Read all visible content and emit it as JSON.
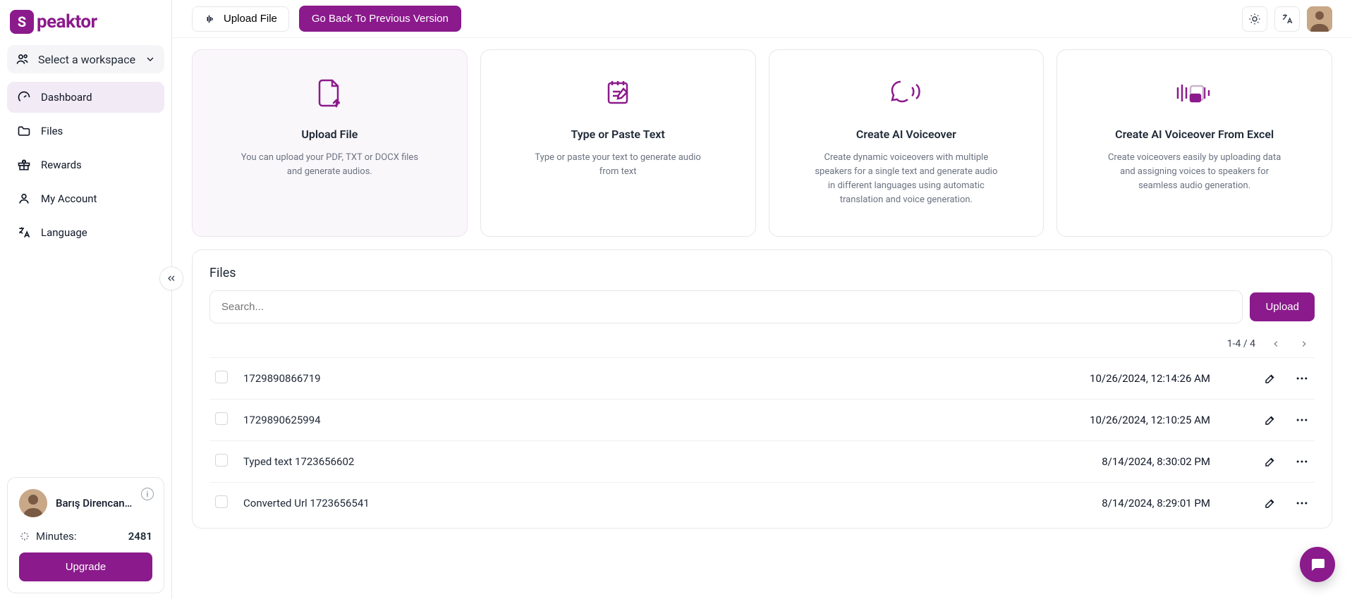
{
  "brand": {
    "name": "peaktor",
    "mark": "S"
  },
  "workspace": {
    "label": "Select a workspace"
  },
  "nav": {
    "dashboard": "Dashboard",
    "files": "Files",
    "rewards": "Rewards",
    "account": "My Account",
    "language": "Language"
  },
  "sidebarFooter": {
    "name": "Barış Direncan ...",
    "minutesLabel": "Minutes:",
    "minutesValue": "2481",
    "upgrade": "Upgrade"
  },
  "topbar": {
    "uploadFile": "Upload File",
    "goBack": "Go Back To Previous Version"
  },
  "cards": [
    {
      "title": "Upload File",
      "desc": "You can upload your PDF, TXT or DOCX files and generate audios."
    },
    {
      "title": "Type or Paste Text",
      "desc": "Type or paste your text to generate audio from text"
    },
    {
      "title": "Create AI Voiceover",
      "desc": "Create dynamic voiceovers with multiple speakers for a single text and generate audio in different languages using automatic translation and voice generation."
    },
    {
      "title": "Create AI Voiceover From Excel",
      "desc": "Create voiceovers easily by uploading data and assigning voices to speakers for seamless audio generation."
    }
  ],
  "files": {
    "heading": "Files",
    "searchPlaceholder": "Search...",
    "uploadLabel": "Upload",
    "pager": "1-4 / 4",
    "rows": [
      {
        "name": "1729890866719",
        "date": "10/26/2024, 12:14:26 AM"
      },
      {
        "name": "1729890625994",
        "date": "10/26/2024, 12:10:25 AM"
      },
      {
        "name": "Typed text 1723656602",
        "date": "8/14/2024, 8:30:02 PM"
      },
      {
        "name": "Converted Url 1723656541",
        "date": "8/14/2024, 8:29:01 PM"
      }
    ]
  }
}
